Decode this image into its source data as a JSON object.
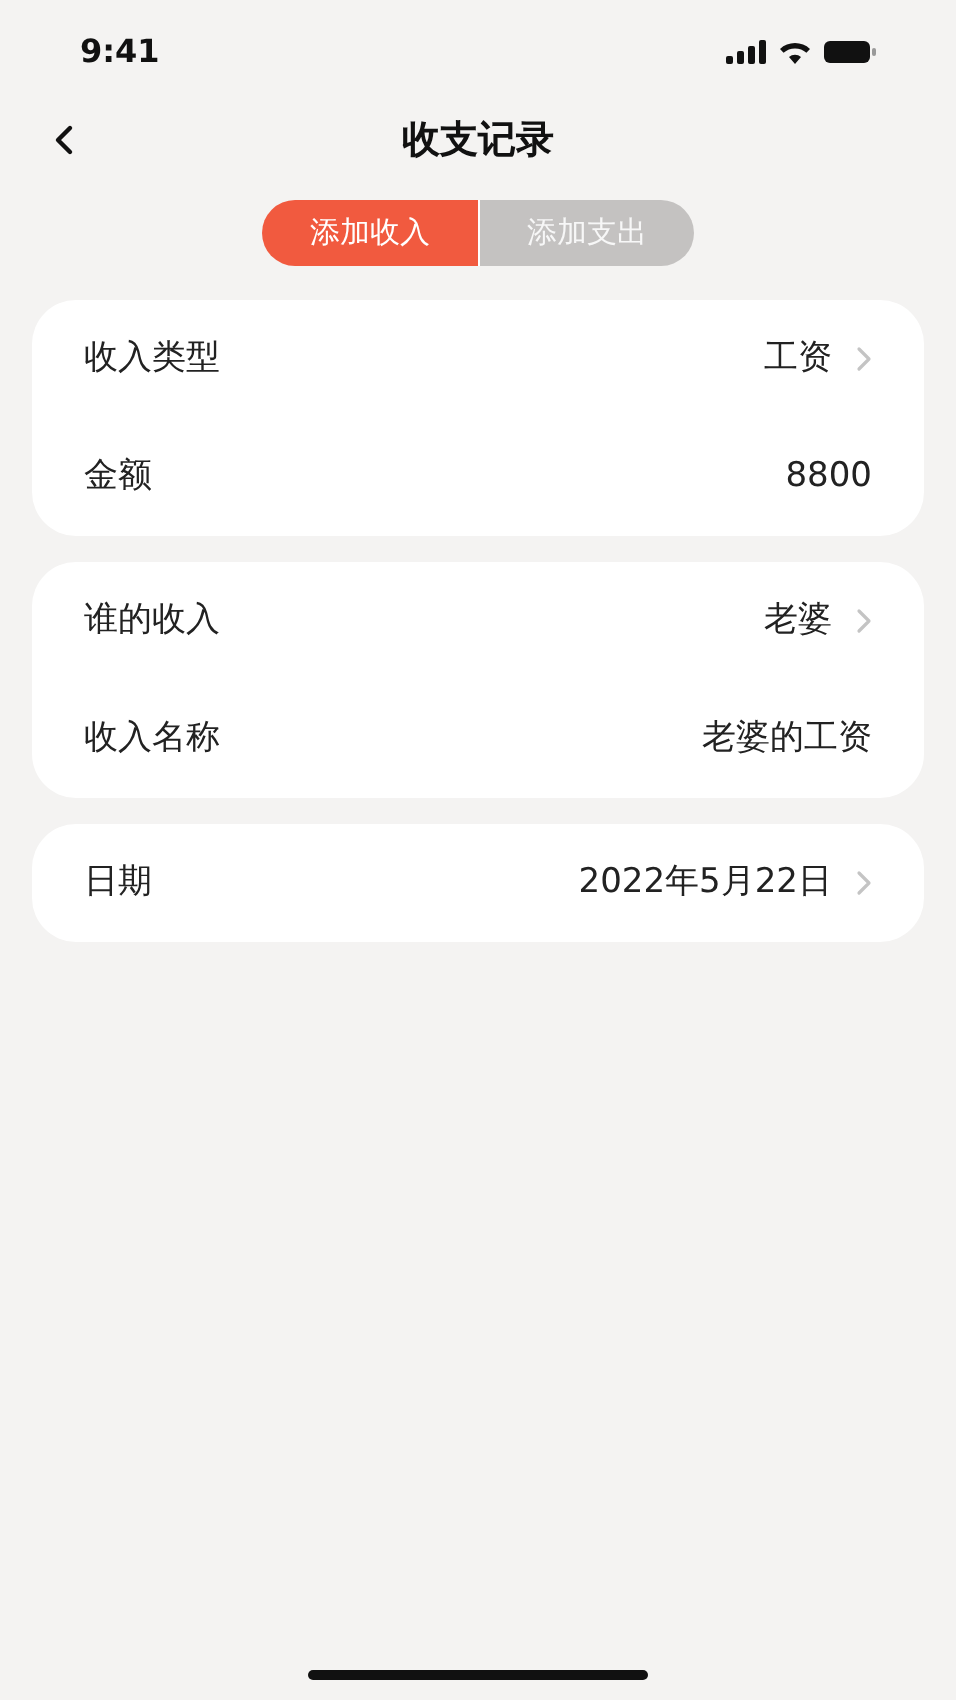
{
  "status_bar": {
    "time": "9:41"
  },
  "header": {
    "title": "收支记录"
  },
  "tabs": [
    {
      "label": "添加收入",
      "selected": true
    },
    {
      "label": "添加支出",
      "selected": false
    }
  ],
  "groups": [
    {
      "rows": [
        {
          "kind": "select",
          "label": "收入类型",
          "value": "工资"
        },
        {
          "kind": "value",
          "label": "金额",
          "value": "8800"
        }
      ]
    },
    {
      "rows": [
        {
          "kind": "select",
          "label": "谁的收入",
          "value": "老婆"
        },
        {
          "kind": "value",
          "label": "收入名称",
          "value": "老婆的工资"
        }
      ]
    },
    {
      "rows": [
        {
          "kind": "select",
          "label": "日期",
          "value": "2022年5月22日"
        }
      ]
    }
  ]
}
